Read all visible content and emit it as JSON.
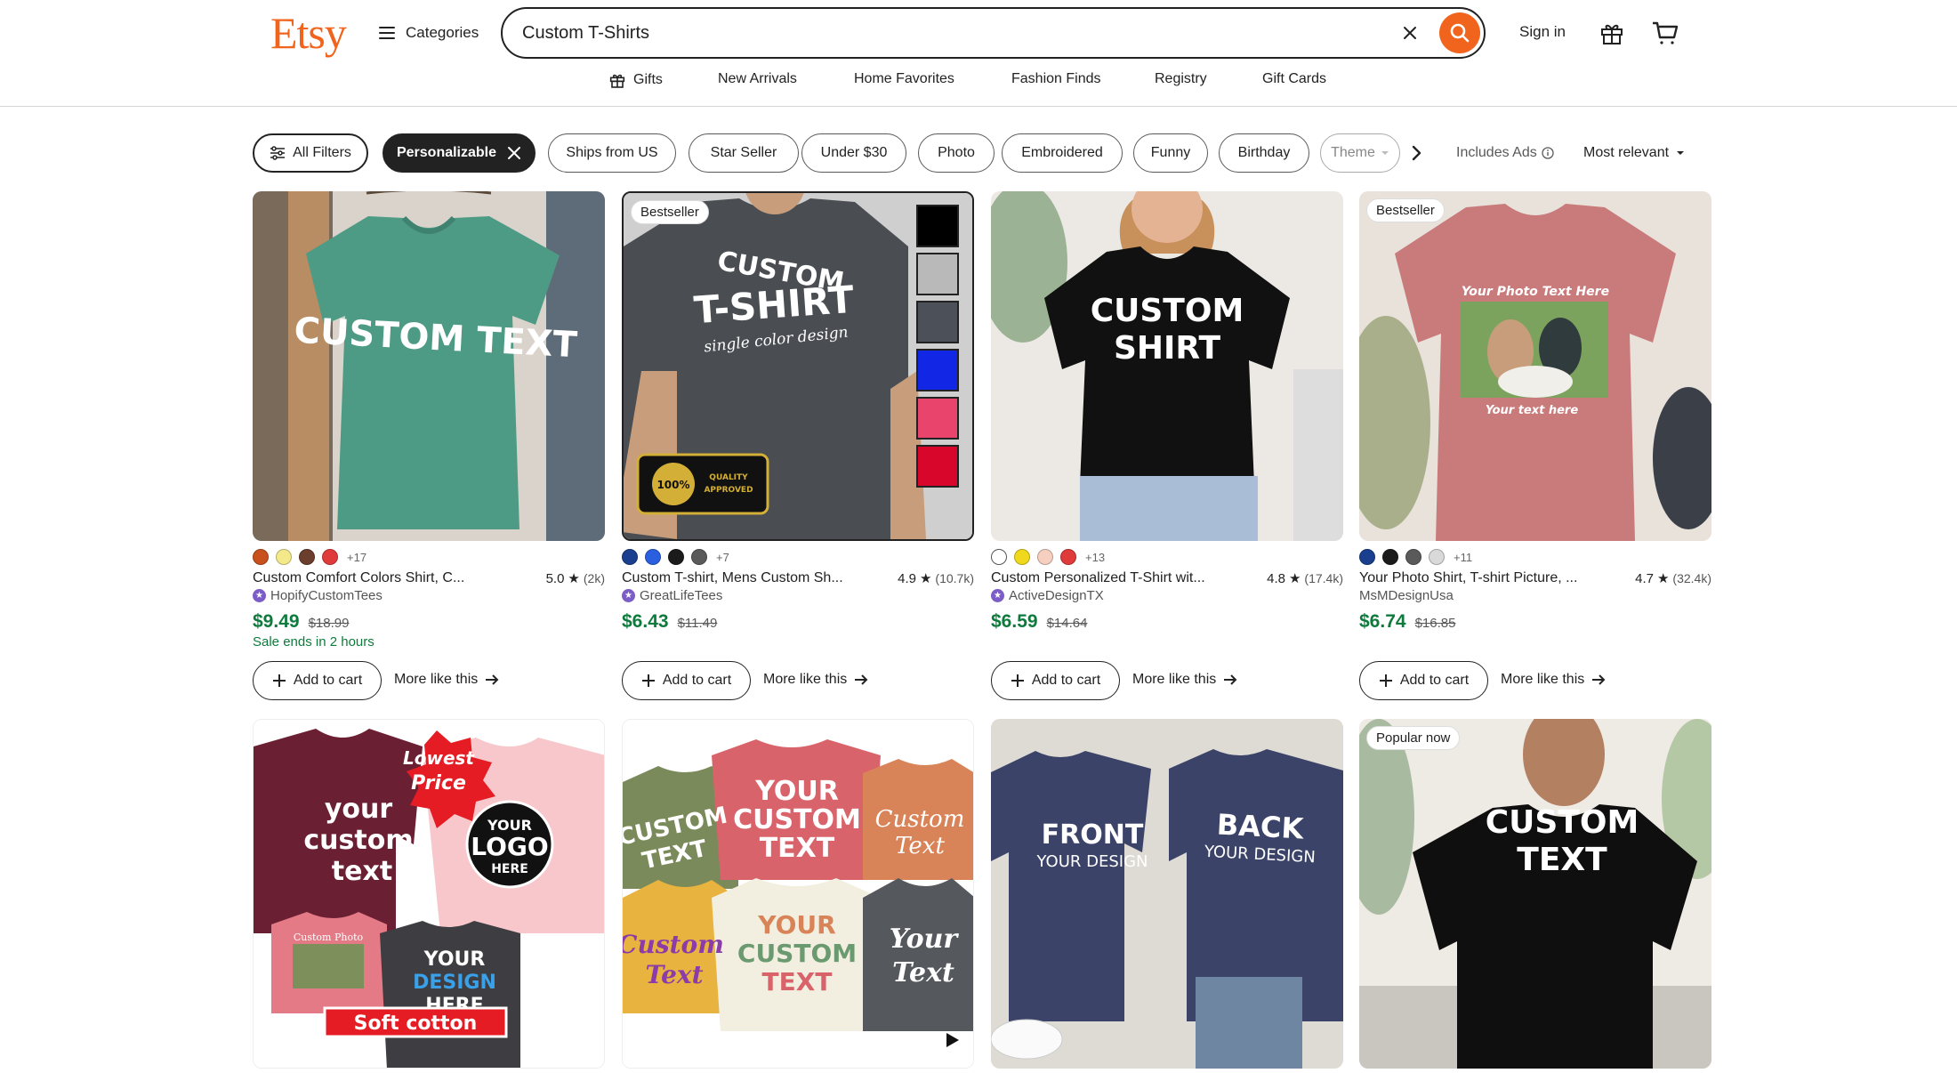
{
  "header": {
    "logo": "Etsy",
    "categories_label": "Categories",
    "search_value": "Custom T-Shirts",
    "signin_label": "Sign in"
  },
  "subnav": [
    "Gifts",
    "New Arrivals",
    "Home Favorites",
    "Fashion Finds",
    "Registry",
    "Gift Cards"
  ],
  "filters": {
    "all_filters": "All Filters",
    "active": "Personalizable",
    "chips": [
      "Ships from US",
      "Star Seller",
      "Under $30",
      "Photo",
      "Embroidered",
      "Funny",
      "Birthday"
    ],
    "theme": "Theme",
    "includes_ads": "Includes Ads",
    "sort": "Most relevant"
  },
  "colors": {
    "accent": "#f1641e",
    "sale_green": "#0e7b3d",
    "star_seller": "#7c5dc7"
  },
  "products": [
    {
      "title": "Custom Comfort Colors Shirt, C...",
      "rating": "5.0",
      "reviews": "(2k)",
      "shop": "HopifyCustomTees",
      "star_seller": true,
      "price": "$9.49",
      "original_price": "$18.99",
      "sale_note": "Sale ends in 2 hours",
      "swatches": [
        "#c8501c",
        "#f3e98a",
        "#6b3e2e",
        "#e03b3b"
      ],
      "more_colors": "+17",
      "badge": "",
      "add_to_cart": "Add to cart",
      "more_like": "More like this",
      "image_text": "CUSTOM TEXT"
    },
    {
      "title": "Custom T-shirt, Mens Custom Sh...",
      "rating": "4.9",
      "reviews": "(10.7k)",
      "shop": "GreatLifeTees",
      "star_seller": true,
      "price": "$6.43",
      "original_price": "$11.49",
      "sale_note": "",
      "swatches": [
        "#1a3f8f",
        "#2a5fe0",
        "#1b1b1b",
        "#5a5a5a"
      ],
      "more_colors": "+7",
      "badge": "Bestseller",
      "add_to_cart": "Add to cart",
      "more_like": "More like this",
      "image_text": "CUSTOM T-SHIRT",
      "image_subtext": "single color design",
      "quality_badge": "QUALITY APPROVED"
    },
    {
      "title": "Custom Personalized T-Shirt wit...",
      "rating": "4.8",
      "reviews": "(17.4k)",
      "shop": "ActiveDesignTX",
      "star_seller": true,
      "price": "$6.59",
      "original_price": "$14.64",
      "sale_note": "",
      "swatches": [
        "#ffffff",
        "#f0d81c",
        "#f6cfc0",
        "#e03b3b"
      ],
      "more_colors": "+13",
      "badge": "",
      "add_to_cart": "Add to cart",
      "more_like": "More like this",
      "image_text": "CUSTOM SHIRT"
    },
    {
      "title": "Your Photo Shirt, T-shirt Picture, ...",
      "rating": "4.7",
      "reviews": "(32.4k)",
      "shop": "MsMDesignUsa",
      "star_seller": false,
      "price": "$6.74",
      "original_price": "$16.85",
      "sale_note": "",
      "swatches": [
        "#1a3f8f",
        "#1b1b1b",
        "#5a5a5a",
        "#d9d9d9"
      ],
      "more_colors": "+11",
      "badge": "Bestseller",
      "add_to_cart": "Add to cart",
      "more_like": "More like this",
      "image_text": "Your Photo Text Here",
      "image_subtext": "Your text here"
    }
  ],
  "products_row2": [
    {
      "badge": "",
      "texts": [
        "Lowest Price",
        "your custom text",
        "YOUR LOGO HERE",
        "YOUR DESIGN HERE",
        "Soft cotton",
        "Custom Photo"
      ]
    },
    {
      "badge": "",
      "texts": [
        "CUSTOM TEXT",
        "YOUR CUSTOM TEXT",
        "Custom Text",
        "Custom Text",
        "YOUR CUSTOM TEXT",
        "Your Text"
      ]
    },
    {
      "badge": "",
      "texts": [
        "FRONT",
        "YOUR DESIGN",
        "BACK",
        "YOUR DESIGN"
      ]
    },
    {
      "badge": "Popular now",
      "texts": [
        "CUSTOM TEXT"
      ]
    }
  ]
}
